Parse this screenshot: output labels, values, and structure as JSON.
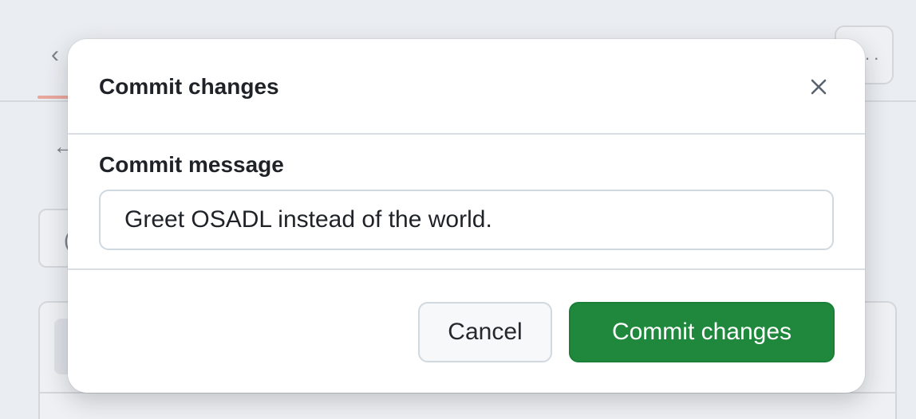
{
  "dialog": {
    "title": "Commit changes",
    "close_icon": "close-icon",
    "message_label": "Commit message",
    "message_value": "Greet OSADL instead of the world.",
    "cancel_label": "Cancel",
    "commit_label": "Commit changes"
  },
  "background": {
    "back_icon": "chevron-left-icon",
    "more_icon": "kebab-horizontal-icon",
    "arrow_icon": "arrow-left-icon"
  },
  "colors": {
    "primary_button": "#1f883d",
    "primary_text": "#ffffff",
    "overlay": "#eaedf1"
  }
}
